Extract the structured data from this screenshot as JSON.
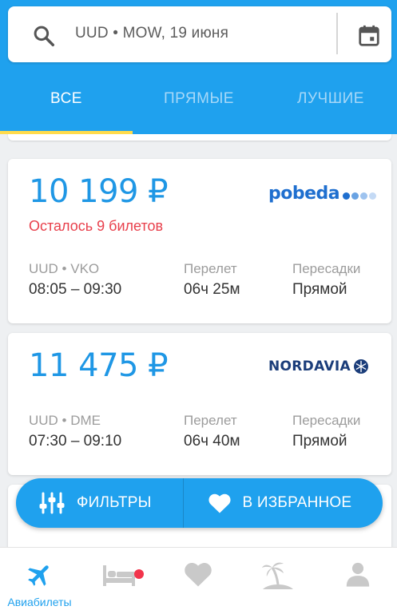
{
  "search": {
    "query": "UUD • MOW, 19 июня"
  },
  "tabs": [
    {
      "label": "ВСЕ",
      "active": true
    },
    {
      "label": "ПРЯМЫЕ",
      "active": false
    },
    {
      "label": "ЛУЧШИЕ",
      "active": false
    }
  ],
  "tickets": [
    {
      "price": "10 199 ₽",
      "availability": "Осталось 9 билетов",
      "airline_logo": "pobeda",
      "route": "UUD • VKO",
      "times": "08:05 – 09:30",
      "duration_label": "Перелет",
      "duration": "06ч 25м",
      "transfers_label": "Пересадки",
      "transfers": "Прямой"
    },
    {
      "price": "11 475 ₽",
      "airline_logo": "NORDAVIA",
      "route": "UUD • DME",
      "times": "07:30 – 09:10",
      "duration_label": "Перелет",
      "duration": "06ч 40м",
      "transfers_label": "Пересадки",
      "transfers": "Прямой"
    }
  ],
  "actions": {
    "filters_label": "ФИЛЬТРЫ",
    "favorites_label": "В ИЗБРАННОЕ"
  },
  "bottom_nav": [
    {
      "icon": "plane-icon",
      "label": "Авиабилеты",
      "active": true
    },
    {
      "icon": "hotel-bed-icon",
      "has_badge": true
    },
    {
      "icon": "heart-icon"
    },
    {
      "icon": "palm-island-icon"
    },
    {
      "icon": "profile-icon"
    }
  ],
  "colors": {
    "primary": "#1fa1ee",
    "price": "#1f97e5",
    "warning": "#e8404c",
    "tab_indicator": "#ffdb4c",
    "badge": "#f2344b",
    "nav_inactive": "#c9c9c9"
  }
}
